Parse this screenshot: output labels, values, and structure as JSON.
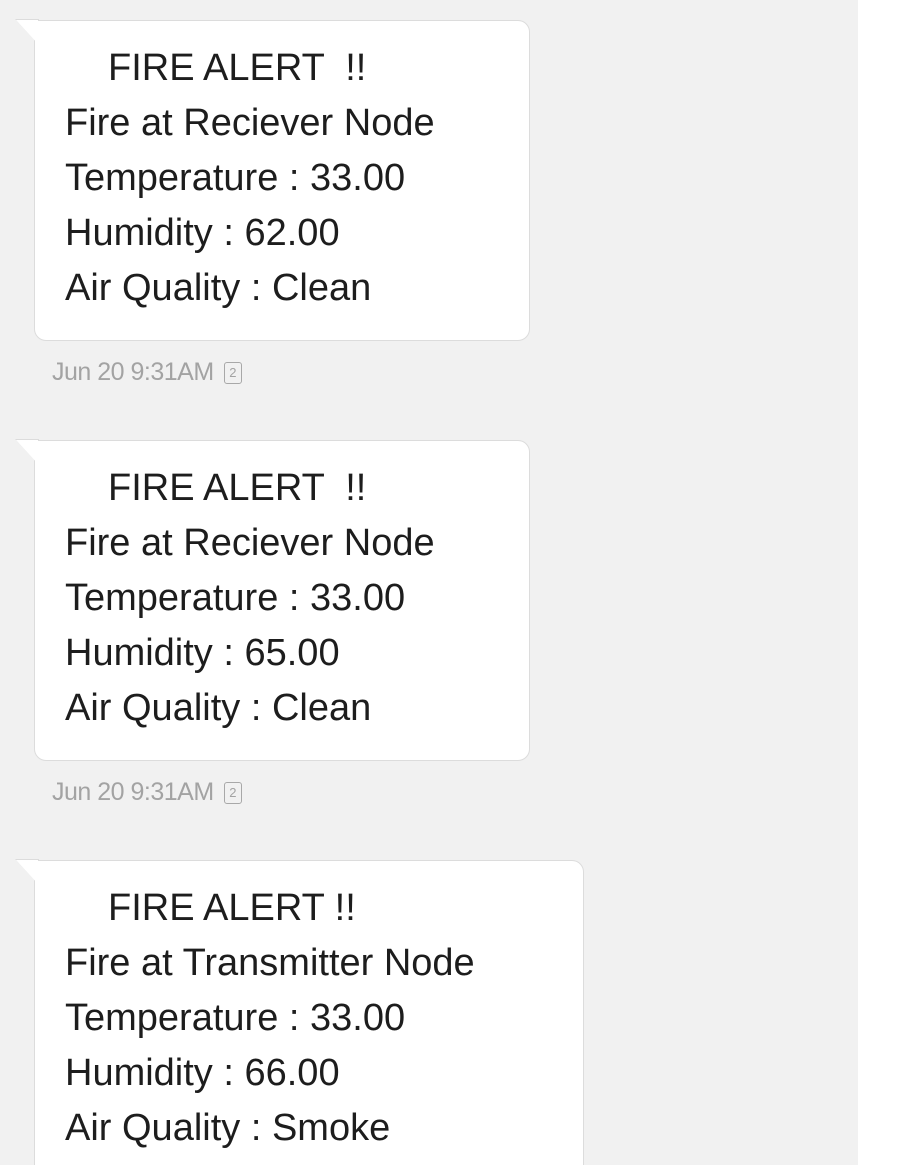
{
  "messages": [
    {
      "lines": [
        "FIRE ALERT  !!",
        "Fire at Reciever Node",
        "Temperature : 33.00",
        "Humidity : 62.00",
        "Air Quality : Clean"
      ],
      "timestamp": "Jun 20 9:31AM",
      "sim": "2"
    },
    {
      "lines": [
        "FIRE ALERT  !!",
        "Fire at Reciever Node",
        "Temperature : 33.00",
        "Humidity : 65.00",
        "Air Quality : Clean"
      ],
      "timestamp": "Jun 20 9:31AM",
      "sim": "2"
    },
    {
      "lines": [
        "FIRE ALERT !!",
        "Fire at Transmitter Node",
        "Temperature : 33.00",
        "Humidity : 66.00",
        "Air Quality : Smoke"
      ]
    }
  ],
  "icons": {
    "sim": "sim-card-icon"
  }
}
